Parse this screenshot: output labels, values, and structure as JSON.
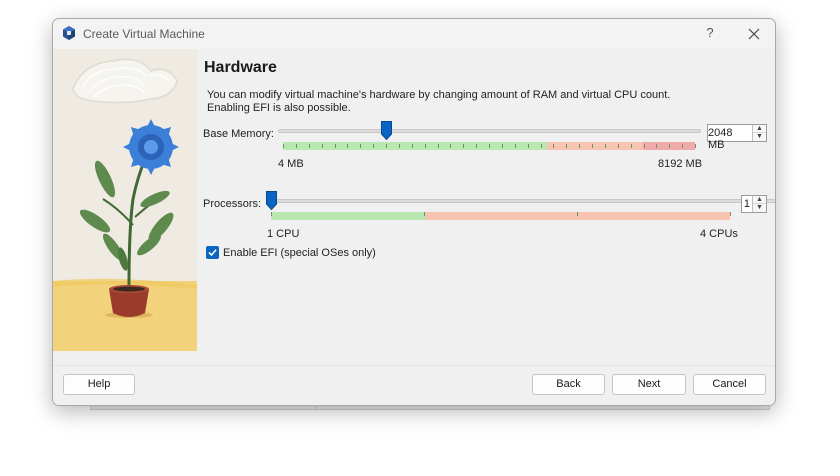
{
  "window": {
    "title": "Create Virtual Machine",
    "help_glyph": "?",
    "icons": {
      "app": "virtualbox-logo-icon",
      "close": "close-icon"
    }
  },
  "page": {
    "heading": "Hardware",
    "description_line1": "You can modify virtual machine's hardware by changing amount of RAM and virtual CPU count.",
    "description_line2": "Enabling EFI is also possible."
  },
  "memory": {
    "label": "Base Memory:",
    "value": "2048 MB",
    "min_label": "4 MB",
    "max_label": "8192 MB",
    "min": 4,
    "max": 8192,
    "current": 2048
  },
  "processors": {
    "label": "Processors:",
    "value": "1",
    "min_label": "1 CPU",
    "max_label": "4 CPUs",
    "min": 1,
    "max": 4,
    "current": 1
  },
  "efi": {
    "label": "Enable EFI (special OSes only)",
    "checked": true
  },
  "buttons": {
    "help": "Help",
    "back": "Back",
    "next": "Next",
    "cancel": "Cancel"
  },
  "colors": {
    "accent": "#0a64c2",
    "zone_green": "#b8e8b0",
    "zone_orange": "#f6c4b0",
    "zone_red": "#f0aaaa"
  }
}
